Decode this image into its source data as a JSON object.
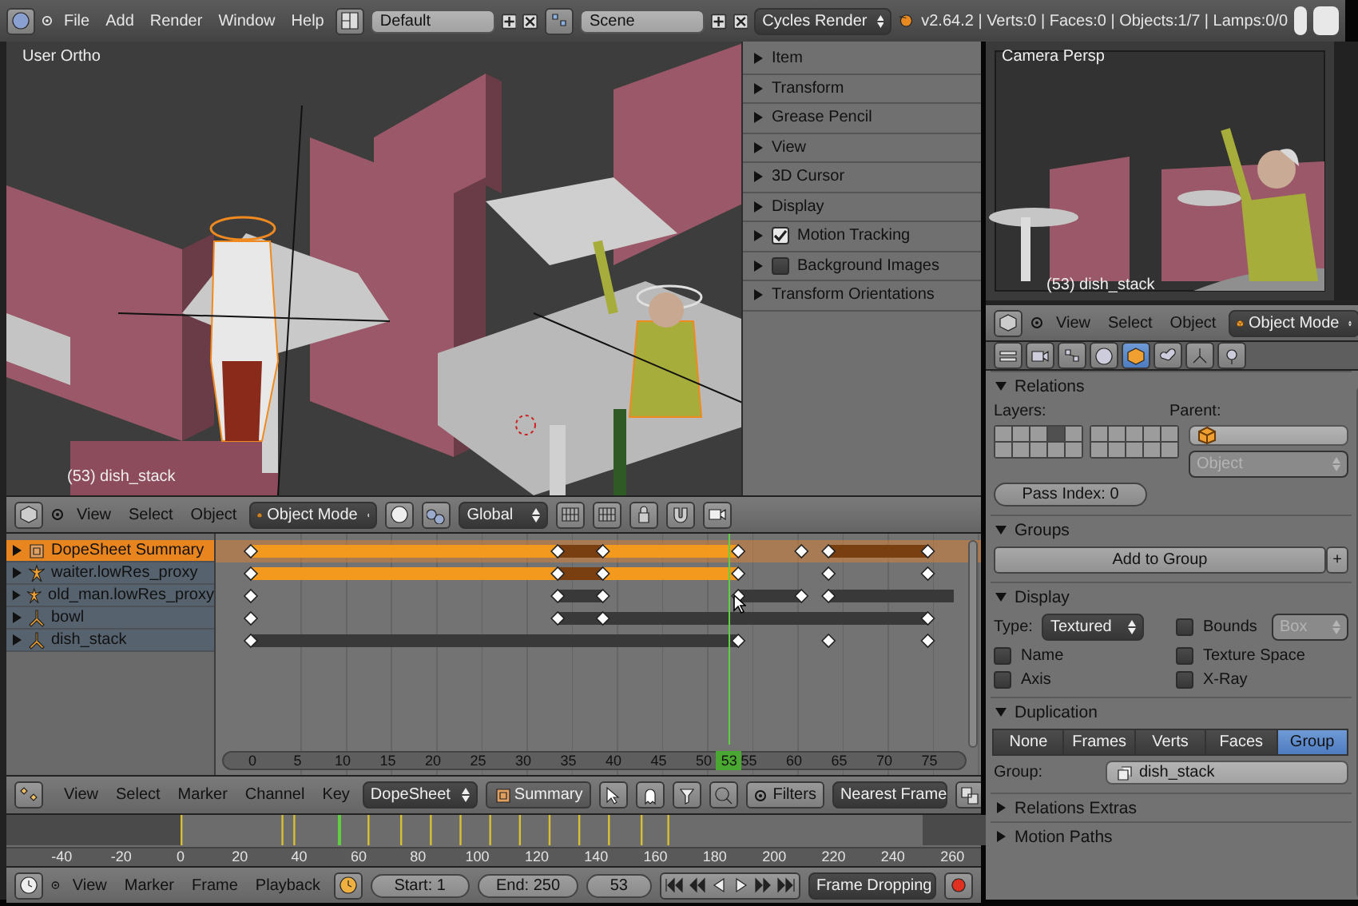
{
  "top_bar": {
    "menus": [
      "File",
      "Add",
      "Render",
      "Window",
      "Help"
    ],
    "screen_layout": "Default",
    "scene": "Scene",
    "render_engine": "Cycles Render",
    "stats": "v2.64.2 | Verts:0 | Faces:0 | Objects:1/7 | Lamps:0/0"
  },
  "viewport": {
    "view_name": "User Ortho",
    "active_object": "(53) dish_stack",
    "tool_panels": [
      {
        "label": "Item",
        "kind": "plain",
        "expanded": false
      },
      {
        "label": "Transform",
        "kind": "plain",
        "expanded": false
      },
      {
        "label": "Grease Pencil",
        "kind": "plain",
        "expanded": false
      },
      {
        "label": "View",
        "kind": "plain",
        "expanded": false
      },
      {
        "label": "3D Cursor",
        "kind": "plain",
        "expanded": false
      },
      {
        "label": "Display",
        "kind": "plain",
        "expanded": false
      },
      {
        "label": "Motion Tracking",
        "kind": "checkbox",
        "expanded": false,
        "checked": true
      },
      {
        "label": "Background Images",
        "kind": "checkbox",
        "expanded": false,
        "checked": false
      },
      {
        "label": "Transform Orientations",
        "kind": "plain",
        "expanded": false
      }
    ]
  },
  "viewport_header": {
    "menus": [
      "View",
      "Select",
      "Object"
    ],
    "mode": "Object Mode",
    "orientation": "Global"
  },
  "dopesheet": {
    "channels": [
      {
        "name": "DopeSheet Summary",
        "kind": "summary",
        "selected": true
      },
      {
        "name": "waiter.lowRes_proxy",
        "kind": "armature",
        "selected": false
      },
      {
        "name": "old_man.lowRes_proxy",
        "kind": "armature",
        "selected": false
      },
      {
        "name": "bowl",
        "kind": "empty",
        "selected": false
      },
      {
        "name": "dish_stack",
        "kind": "empty",
        "selected": false
      }
    ],
    "ruler": [
      "0",
      "5",
      "10",
      "15",
      "20",
      "25",
      "30",
      "35",
      "40",
      "45",
      "50",
      "55",
      "60",
      "65",
      "70",
      "75"
    ],
    "current_frame": "53"
  },
  "dopesheet_header": {
    "menus": [
      "View",
      "Select",
      "Marker",
      "Channel",
      "Key"
    ],
    "mode": "DopeSheet",
    "summary": "Summary",
    "filters": "Filters",
    "snap": "Nearest Frame"
  },
  "timeline": {
    "ruler": [
      "-40",
      "-20",
      "0",
      "20",
      "40",
      "60",
      "80",
      "100",
      "120",
      "140",
      "160",
      "180",
      "200",
      "220",
      "240",
      "260"
    ]
  },
  "timeline_header": {
    "menus": [
      "View",
      "Marker",
      "Frame",
      "Playback"
    ],
    "start": "Start: 1",
    "end": "End: 250",
    "frame": "53",
    "sync": "Frame Dropping"
  },
  "camera_view": {
    "view_name": "Camera Persp",
    "active_object": "(53) dish_stack"
  },
  "properties_header": {
    "menus": [
      "View",
      "Select",
      "Object"
    ],
    "mode": "Object Mode"
  },
  "properties": {
    "context_tabs": [
      {
        "kind": "render",
        "selected": false
      },
      {
        "kind": "scene",
        "selected": false
      },
      {
        "kind": "world",
        "selected": false
      },
      {
        "kind": "object",
        "selected": true
      },
      {
        "kind": "constraints",
        "selected": false
      },
      {
        "kind": "data",
        "selected": false
      },
      {
        "kind": "material",
        "selected": false
      }
    ],
    "relations": {
      "title": "Relations",
      "expanded": true,
      "layers_label": "Layers:",
      "parent_label": "Parent:",
      "parent_type": "Object",
      "pass_index": "Pass Index: 0",
      "layers": [
        {
          "on": false
        },
        {
          "on": false
        },
        {
          "on": false
        },
        {
          "on": true
        },
        {
          "on": false
        },
        {
          "on": false
        },
        {
          "on": false
        },
        {
          "on": false
        },
        {
          "on": false
        },
        {
          "on": false
        },
        {
          "on": false
        },
        {
          "on": false
        },
        {
          "on": false
        },
        {
          "on": false
        },
        {
          "on": false
        },
        {
          "on": false
        },
        {
          "on": false
        },
        {
          "on": false
        },
        {
          "on": false
        },
        {
          "on": false
        }
      ]
    },
    "groups": {
      "title": "Groups",
      "expanded": true,
      "add_button": "Add to Group",
      "add_icon": "+"
    },
    "display": {
      "title": "Display",
      "expanded": true,
      "type_label": "Type:",
      "type": "Textured",
      "bounds_type": "Box",
      "options": [
        {
          "label": "Bounds",
          "checked": false
        },
        {
          "label": "Name",
          "checked": false
        },
        {
          "label": "Texture Space",
          "checked": false
        },
        {
          "label": "Axis",
          "checked": false
        },
        {
          "label": "X-Ray",
          "checked": false
        }
      ]
    },
    "duplication": {
      "title": "Duplication",
      "expanded": true,
      "group_label": "Group:",
      "group": "dish_stack",
      "modes": [
        {
          "label": "None",
          "selected": false
        },
        {
          "label": "Frames",
          "selected": false
        },
        {
          "label": "Verts",
          "selected": false
        },
        {
          "label": "Faces",
          "selected": false
        },
        {
          "label": "Group",
          "selected": true
        }
      ]
    },
    "collapsed_sections": [
      {
        "title": "Relations Extras",
        "expanded": false
      },
      {
        "title": "Motion Paths",
        "expanded": false
      }
    ]
  }
}
